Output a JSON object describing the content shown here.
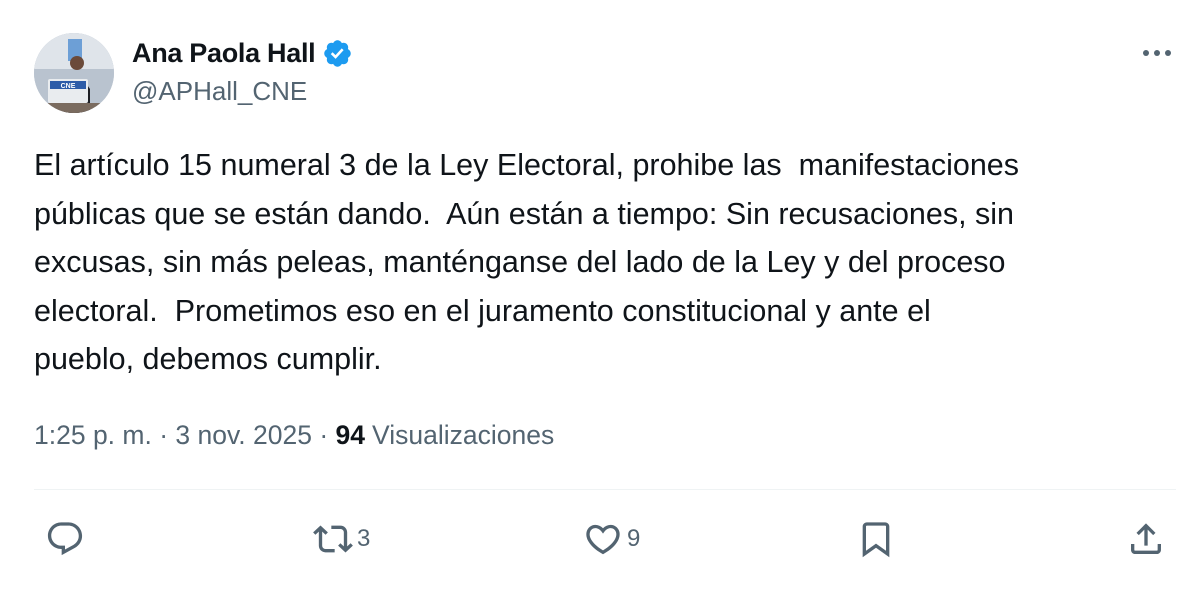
{
  "author": {
    "display_name": "Ana Paola Hall",
    "handle": "@APHall_CNE",
    "verified_badge_color": "#1d9bf0",
    "avatar_text": "CNE"
  },
  "tweet": {
    "text": "El artículo 15 numeral 3 de la Ley Electoral, prohibe las  manifestaciones\npúblicas que se están dando.  Aún están a tiempo: Sin recusaciones, sin\nexcusas, sin más peleas, manténganse del lado de la Ley y del proceso\nelectoral.  Prometimos eso en el juramento constitucional y ante el\npueblo, debemos cumplir.",
    "time": "1:25 p. m.",
    "separator": "·",
    "date": "3 nov. 2025",
    "views_count": "94",
    "views_label": "Visualizaciones"
  },
  "actions": {
    "reply_icon": "speech-bubble-icon",
    "repost_icon": "repost-arrows-icon",
    "repost_count": "3",
    "like_icon": "heart-icon",
    "like_count": "9",
    "bookmark_icon": "bookmark-icon",
    "share_icon": "share-upload-icon"
  },
  "more_icon": "ellipsis-icon",
  "colors": {
    "text_primary": "#0f1419",
    "text_secondary": "#536471",
    "divider": "#eff3f4",
    "accent": "#1d9bf0"
  }
}
